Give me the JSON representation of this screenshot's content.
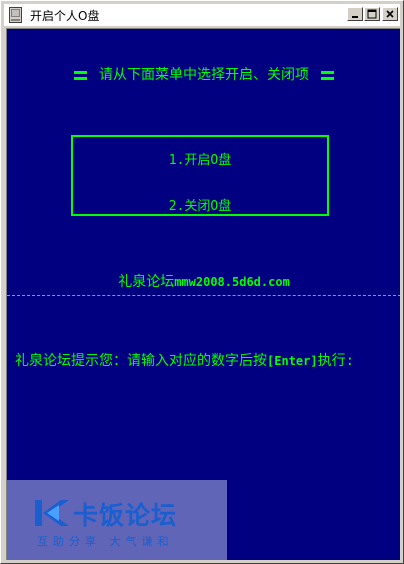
{
  "window": {
    "title": "开启个人O盘",
    "icon": "console-window-icon"
  },
  "colors": {
    "background": "#000080",
    "text": "#00ff00",
    "watermark": "#1a5fd0"
  },
  "console": {
    "header": "请从下面菜单中选择开启、关闭项",
    "menu": {
      "items": [
        {
          "label": "1.开启O盘"
        },
        {
          "label": "2.关闭O盘"
        }
      ]
    },
    "forum": {
      "name": "礼泉论坛",
      "url": "mmw2008.5d6d.com"
    },
    "prompt": {
      "before": "礼泉论坛提示您：请输入对应的数字后按",
      "key": "[Enter]",
      "after": "执行:"
    }
  },
  "watermark": {
    "name": "卡饭论坛",
    "slogan": "互助分享 大气谦和"
  }
}
